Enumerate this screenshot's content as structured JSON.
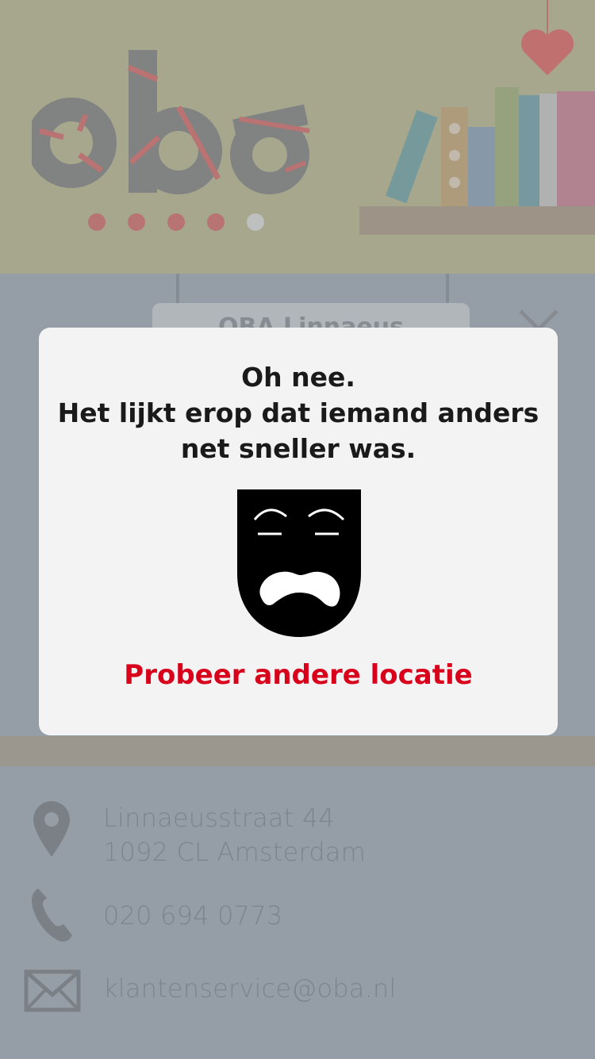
{
  "header": {
    "logo_text": "oba",
    "logo_dots": 5
  },
  "location": {
    "name": "OBA Linnaeus",
    "address_line1": "Linnaeusstraat 44",
    "address_line2": "1092 CL Amsterdam",
    "phone": "020 694 0773",
    "email": "klantenservice@oba.nl"
  },
  "modal": {
    "title_line1": "Oh nee.",
    "title_line2": "Het lijkt erop dat iemand anders",
    "title_line3": "net sneller was.",
    "icon": "sad-theater-mask-icon",
    "action_label": "Probeer andere locatie"
  },
  "colors": {
    "accent_red": "#d9001b",
    "header_bg": "#adac91",
    "content_bg": "#9aa3ac",
    "modal_bg": "#f3f3f3"
  }
}
